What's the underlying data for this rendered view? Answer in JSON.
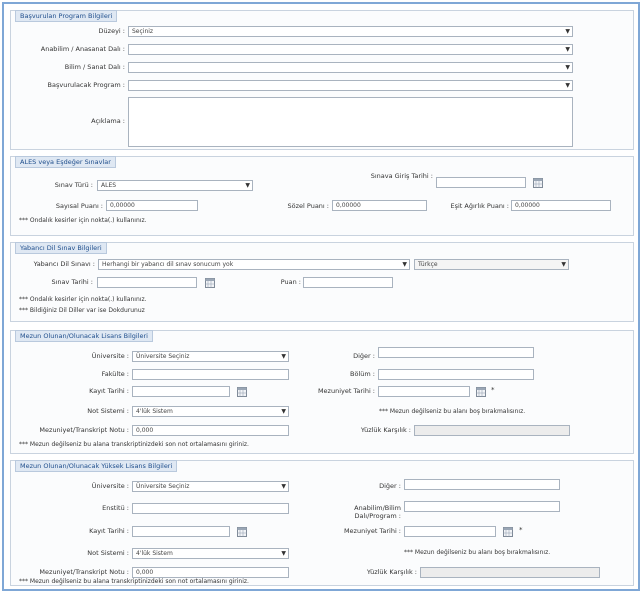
{
  "s1": {
    "title": "Başvurulan Program Bilgileri",
    "level_label": "Düzeyi :",
    "level_value": "Seçiniz",
    "study_label": "Anabilim / Anasanat Dalı :",
    "study_value": "",
    "dept_label": "Bilim / Sanat Dalı :",
    "dept_value": "",
    "prog_label": "Başvurulacak Program :",
    "prog_value": "",
    "desc_label": "Açıklama :"
  },
  "s2": {
    "title": "ALES veya Eşdeğer Sınavlar",
    "exam_type_label": "Sınav Türü :",
    "exam_type_value": "ALES",
    "exam_date_label": "Sınava Giriş Tarihi :",
    "num_label": "Sayısal Puanı :",
    "num_value": "0,00000",
    "verbal_label": "Sözel Puanı :",
    "verbal_value": "0,00000",
    "eq_label": "Eşit Ağırlık Puanı :",
    "eq_value": "0,00000",
    "note": "*** Ondalık kesirler için nokta(.) kullanınız."
  },
  "s3": {
    "title": "Yabancı Dil Sınav Bilgileri",
    "lang_exam_label": "Yabancı Dil Sınavı :",
    "lang_exam_value": "Herhangi bir yabancı dil sınav sonucum yok",
    "lang_value": "Türkçe",
    "date_label": "Sınav Tarihi :",
    "score_label": "Puan :",
    "note1": "*** Ondalık kesirler için nokta(.) kullanınız.",
    "note2": "*** Bildiğiniz Dil Diller var ise Dokdurunuz"
  },
  "s4": {
    "title": "Mezun Olunan/Olunacak Lisans Bilgileri",
    "uni_label": "Üniversite :",
    "uni_value": "Üniversite Seçiniz",
    "other_label": "Diğer :",
    "fac_label": "Fakülte :",
    "dept_label": "Bölüm :",
    "entry_label": "Kayıt Tarihi :",
    "grad_label": "Mezuniyet Tarihi :",
    "grade_sys_label": "Not Sistemi :",
    "grade_sys_value": "4'lük Sistem",
    "gpa_label": "Mezuniyet/Transkript Notu :",
    "gpa_value": "0,000",
    "equiv_label": "Yüzlük Karşılık :",
    "star": "*",
    "note_grad": "*** Mezun değilseniz bu alanı boş bırakmalısınız.",
    "note_gpa": "*** Mezun değilseniz bu alana transkriptinizdeki son not ortalamasını giriniz."
  },
  "s5": {
    "title": "Mezun Olunan/Olunacak Yüksek Lisans Bilgileri",
    "uni_label": "Üniversite :",
    "uni_value": "Üniversite Seçiniz",
    "other_label": "Diğer :",
    "inst_label": "Enstitü :",
    "abd_label": "Anabilim/Bilim Dalı/Program :",
    "entry_label": "Kayıt Tarihi :",
    "grad_label": "Mezuniyet Tarihi :",
    "grade_sys_label": "Not Sistemi :",
    "grade_sys_value": "4'lük Sistem",
    "gpa_label": "Mezuniyet/Transkript Notu :",
    "gpa_value": "0,000",
    "equiv_label": "Yüzlük Karşılık :",
    "star": "*",
    "note_grad": "*** Mezun değilseniz bu alanı boş bırakmalısınız.",
    "note_gpa": "*** Mezun değilseniz bu alana transkriptinizdeki son not ortalamasını giriniz."
  },
  "icons": {
    "dropdown": "chevron-down-icon",
    "calendar": "calendar-icon"
  },
  "colors": {
    "frame": "#7fa7d6",
    "legend_text": "#1f4e8c",
    "legend_bg": "#dfe8f3"
  }
}
